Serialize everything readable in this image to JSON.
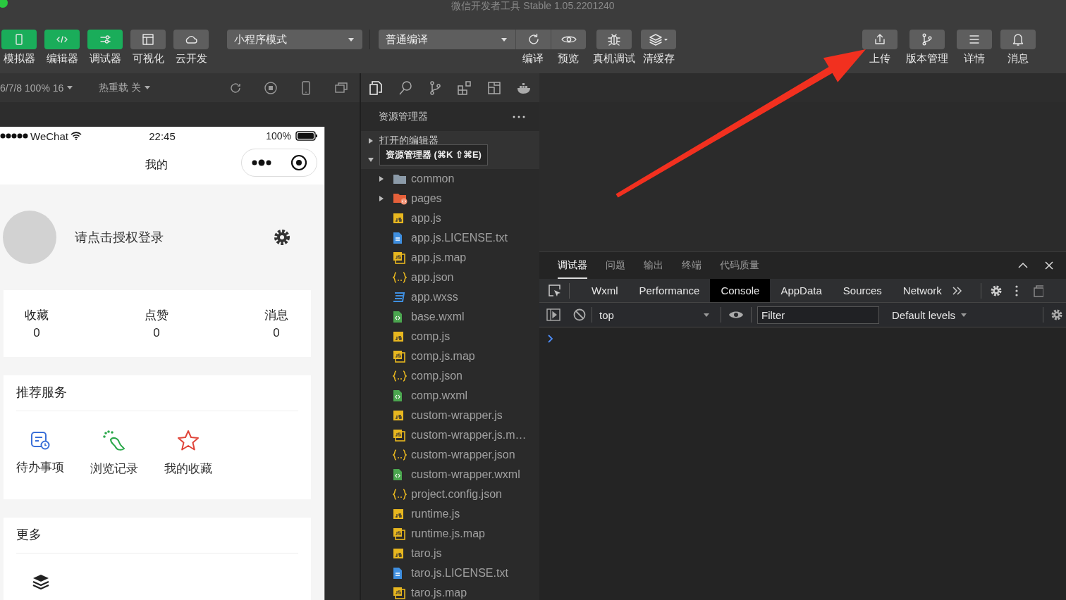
{
  "window": {
    "title": "微信开发者工具 Stable 1.05.2201240"
  },
  "toolbar": {
    "view_buttons": [
      {
        "label": "模拟器",
        "on": true
      },
      {
        "label": "编辑器",
        "on": true
      },
      {
        "label": "调试器",
        "on": true
      },
      {
        "label": "可视化",
        "on": false
      },
      {
        "label": "云开发",
        "on": false
      }
    ],
    "mode_select": "小程序模式",
    "compile_select": "普通编译",
    "compile_buttons": [
      "编译",
      "预览"
    ],
    "device_buttons": [
      "真机调试",
      "清缓存"
    ],
    "right_buttons": [
      "上传",
      "版本管理",
      "详情",
      "消息"
    ]
  },
  "simulator": {
    "device": "6/7/8 100% 16",
    "hot_reload": "热重载 关"
  },
  "phone": {
    "carrier": "WeChat",
    "time": "22:45",
    "battery": "100%",
    "page_title": "我的",
    "login_text": "请点击授权登录",
    "stats": [
      {
        "label": "收藏",
        "value": "0"
      },
      {
        "label": "点赞",
        "value": "0"
      },
      {
        "label": "消息",
        "value": "0"
      }
    ],
    "sections": [
      {
        "title": "推荐服务",
        "items": [
          "待办事项",
          "浏览记录",
          "我的收藏"
        ]
      },
      {
        "title": "更多"
      }
    ]
  },
  "explorer": {
    "title": "资源管理器",
    "sections": [
      {
        "label": "打开的编辑器",
        "expanded": false
      },
      {
        "expanded": true
      }
    ],
    "tooltip": "资源管理器 (⌘K ⇧⌘E)",
    "files": [
      {
        "name": "common",
        "kind": "folder",
        "expanded": false
      },
      {
        "name": "pages",
        "kind": "page-folder",
        "expanded": false
      },
      {
        "name": "app.js",
        "kind": "js"
      },
      {
        "name": "app.js.LICENSE.txt",
        "kind": "txt"
      },
      {
        "name": "app.js.map",
        "kind": "map"
      },
      {
        "name": "app.json",
        "kind": "json"
      },
      {
        "name": "app.wxss",
        "kind": "wxss"
      },
      {
        "name": "base.wxml",
        "kind": "wxml"
      },
      {
        "name": "comp.js",
        "kind": "js"
      },
      {
        "name": "comp.js.map",
        "kind": "map"
      },
      {
        "name": "comp.json",
        "kind": "json"
      },
      {
        "name": "comp.wxml",
        "kind": "wxml"
      },
      {
        "name": "custom-wrapper.js",
        "kind": "js"
      },
      {
        "name": "custom-wrapper.js.m…",
        "kind": "map"
      },
      {
        "name": "custom-wrapper.json",
        "kind": "json"
      },
      {
        "name": "custom-wrapper.wxml",
        "kind": "wxml"
      },
      {
        "name": "project.config.json",
        "kind": "json"
      },
      {
        "name": "runtime.js",
        "kind": "js"
      },
      {
        "name": "runtime.js.map",
        "kind": "map"
      },
      {
        "name": "taro.js",
        "kind": "js"
      },
      {
        "name": "taro.js.LICENSE.txt",
        "kind": "txt"
      },
      {
        "name": "taro.js.map",
        "kind": "map"
      }
    ]
  },
  "debugger": {
    "tabs": [
      {
        "label": "调试器",
        "selected": true
      },
      {
        "label": "问题",
        "selected": false
      },
      {
        "label": "输出",
        "selected": false
      },
      {
        "label": "终端",
        "selected": false
      },
      {
        "label": "代码质量",
        "selected": false
      }
    ],
    "devtools_tabs": [
      {
        "label": "Wxml",
        "selected": false
      },
      {
        "label": "Performance",
        "selected": false
      },
      {
        "label": "Console",
        "selected": true
      },
      {
        "label": "AppData",
        "selected": false
      },
      {
        "label": "Sources",
        "selected": false
      },
      {
        "label": "Network",
        "selected": false
      }
    ],
    "console": {
      "context": "top",
      "filter_placeholder": "Filter",
      "levels": "Default levels"
    }
  }
}
